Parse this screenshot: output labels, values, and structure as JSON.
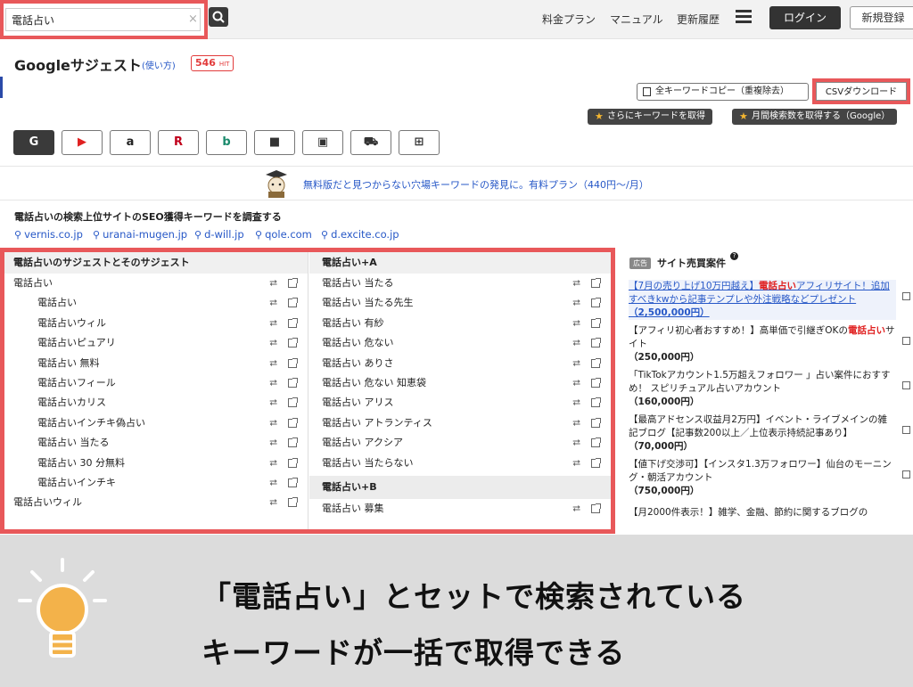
{
  "header": {
    "search_value": "電話占い",
    "search_clear": "×",
    "nav": [
      "料金プラン",
      "マニュアル",
      "更新履歴"
    ],
    "login_label": "ログイン",
    "signup_label": "新規登録"
  },
  "title_block": {
    "title": "Googleサジェスト",
    "help": "(使い方)",
    "hit_count": "546",
    "hit_unit": "HIT"
  },
  "toolbar": {
    "copy_label": "全キーワードコピー（重複除去）",
    "csv_label": "CSVダウンロード",
    "more_keywords_label": "さらにキーワードを取得",
    "monthly_volume_label": "月間検索数を取得する（Google）"
  },
  "sources": [
    {
      "glyph": "G",
      "icon": "google-icon"
    },
    {
      "glyph": "▶",
      "icon": "youtube-icon"
    },
    {
      "glyph": "a",
      "icon": "amazon-icon"
    },
    {
      "glyph": "R",
      "icon": "rakuten-icon"
    },
    {
      "glyph": "b",
      "icon": "bing-icon"
    },
    {
      "glyph": "■",
      "icon": "video-icon"
    },
    {
      "glyph": "▣",
      "icon": "image-icon"
    },
    {
      "glyph": "⛟",
      "icon": "shopping-icon"
    },
    {
      "glyph": "⊞",
      "icon": "windows-icon"
    }
  ],
  "promo": {
    "text": "無料版だと見つからない穴場キーワードの発見に。有料プラン（440円〜/月）"
  },
  "seo": {
    "title": "電話占いの検索上位サイトのSEO獲得キーワードを調査する",
    "sites": [
      "vernis.co.jp",
      "uranai-mugen.jp",
      "d-will.jp",
      "qole.com",
      "d.excite.co.jp"
    ]
  },
  "suggest_left": {
    "heading": "電話占いのサジェストとそのサジェスト",
    "rows": [
      {
        "text": "電話占い",
        "sub": false
      },
      {
        "text": "電話占い",
        "sub": true
      },
      {
        "text": "電話占いウィル",
        "sub": true
      },
      {
        "text": "電話占いピュアリ",
        "sub": true
      },
      {
        "text": "電話占い 無料",
        "sub": true
      },
      {
        "text": "電話占いフィール",
        "sub": true
      },
      {
        "text": "電話占いカリス",
        "sub": true
      },
      {
        "text": "電話占いインチキ偽占い",
        "sub": true
      },
      {
        "text": "電話占い 当たる",
        "sub": true
      },
      {
        "text": "電話占い 30 分無料",
        "sub": true
      },
      {
        "text": "電話占いインチキ",
        "sub": true
      },
      {
        "text": "電話占いウィル",
        "sub": false
      }
    ]
  },
  "suggest_mid": {
    "heading_a": "電話占い+A",
    "rows_a": [
      "電話占い 当たる",
      "電話占い 当たる先生",
      "電話占い 有紗",
      "電話占い 危ない",
      "電話占い ありさ",
      "電話占い 危ない 知恵袋",
      "電話占い アリス",
      "電話占い アトランティス",
      "電話占い アクシア",
      "電話占い 当たらない"
    ],
    "heading_b": "電話占い+B",
    "rows_b": [
      "電話占い 募集"
    ]
  },
  "ads": {
    "badge": "広告",
    "title": "サイト売買案件",
    "help": "?",
    "items": [
      {
        "pre": "【7月の売り上げ10万円越え】",
        "red": "電話占い",
        "post": "アフィリサイト！追加すべきkwから記事テンプレや外注戦略などプレゼント",
        "price": "（2,500,000円）"
      },
      {
        "pre": "【アフィリ初心者おすすめ！】高単価で引継ぎOKの",
        "red": "電話占い",
        "post": "サイト",
        "price": "（250,000円）"
      },
      {
        "pre": "「TikTokアカウント1.5万超えフォロワー 」占い案件におすすめ！ スピリチュアル占いアカウント",
        "red": "",
        "post": "",
        "price": "（160,000円）"
      },
      {
        "pre": "【最高アドセンス収益月2万円】イベント・ライブメインの雑記ブログ【記事数200以上／上位表示持続記事あり】",
        "red": "",
        "post": "",
        "price": "（70,000円）"
      },
      {
        "pre": "【値下げ交渉可】【インスタ1.3万フォロワー】仙台のモーニング・朝活アカウント",
        "red": "",
        "post": "",
        "price": "（750,000円）"
      },
      {
        "pre": "【月2000件表示！】雑学、金融、節約に関するブログの",
        "red": "",
        "post": "",
        "price": ""
      }
    ]
  },
  "banner": {
    "line1": "「電話占い」とセットで検索されている",
    "line2": "キーワードが一括で取得できる"
  },
  "colors": {
    "highlight": "#e8585a",
    "link": "#2758c7",
    "dark": "#333333",
    "banner_bg": "#dcdcdc",
    "bulb": "#f3b24a"
  }
}
